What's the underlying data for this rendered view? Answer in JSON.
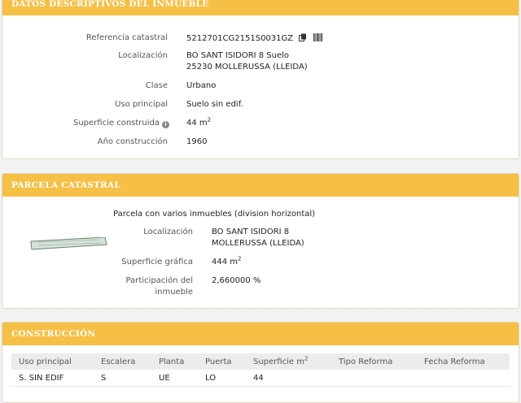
{
  "datos": {
    "title": "DATOS DESCRIPTIVOS DEL INMUEBLE",
    "referencia_label": "Referencia catastral",
    "referencia_value": "5212701CG2151S0031GZ",
    "localizacion_label": "Localización",
    "localizacion_line1": "BO SANT ISIDORI 8 Suelo",
    "localizacion_line2": "25230 MOLLERUSSA (LLEIDA)",
    "clase_label": "Clase",
    "clase_value": "Urbano",
    "uso_label": "Uso principal",
    "uso_value": "Suelo sin edif.",
    "superficie_label": "Superficie construida",
    "superficie_value": "44 m",
    "superficie_unit_sup": "2",
    "info_icon_glyph": "i",
    "anio_label": "Año construcción",
    "anio_value": "1960"
  },
  "parcela": {
    "title": "PARCELA CATASTRAL",
    "descripcion": "Parcela con varios inmuebles (division horizontal)",
    "localizacion_label": "Localización",
    "localizacion_line1": "BO SANT ISIDORI 8",
    "localizacion_line2": "MOLLERUSSA (LLEIDA)",
    "superficie_label": "Superficie gráfica",
    "superficie_value": "444 m",
    "superficie_unit_sup": "2",
    "participacion_label_line1": "Participación del",
    "participacion_label_line2": "inmueble",
    "participacion_value": "2,660000 %"
  },
  "construccion": {
    "title": "CONSTRUCCIÓN",
    "columns": {
      "uso": "Uso principal",
      "escalera": "Escalera",
      "planta": "Planta",
      "puerta": "Puerta",
      "superficie": "Superficie m",
      "superficie_sup": "2",
      "tipo_reforma": "Tipo Reforma",
      "fecha_reforma": "Fecha Reforma"
    },
    "rows": [
      {
        "uso": "S. SIN EDIF",
        "escalera": "S",
        "planta": "UE",
        "puerta": "LO",
        "superficie": "44",
        "tipo_reforma": "",
        "fecha_reforma": ""
      }
    ]
  }
}
